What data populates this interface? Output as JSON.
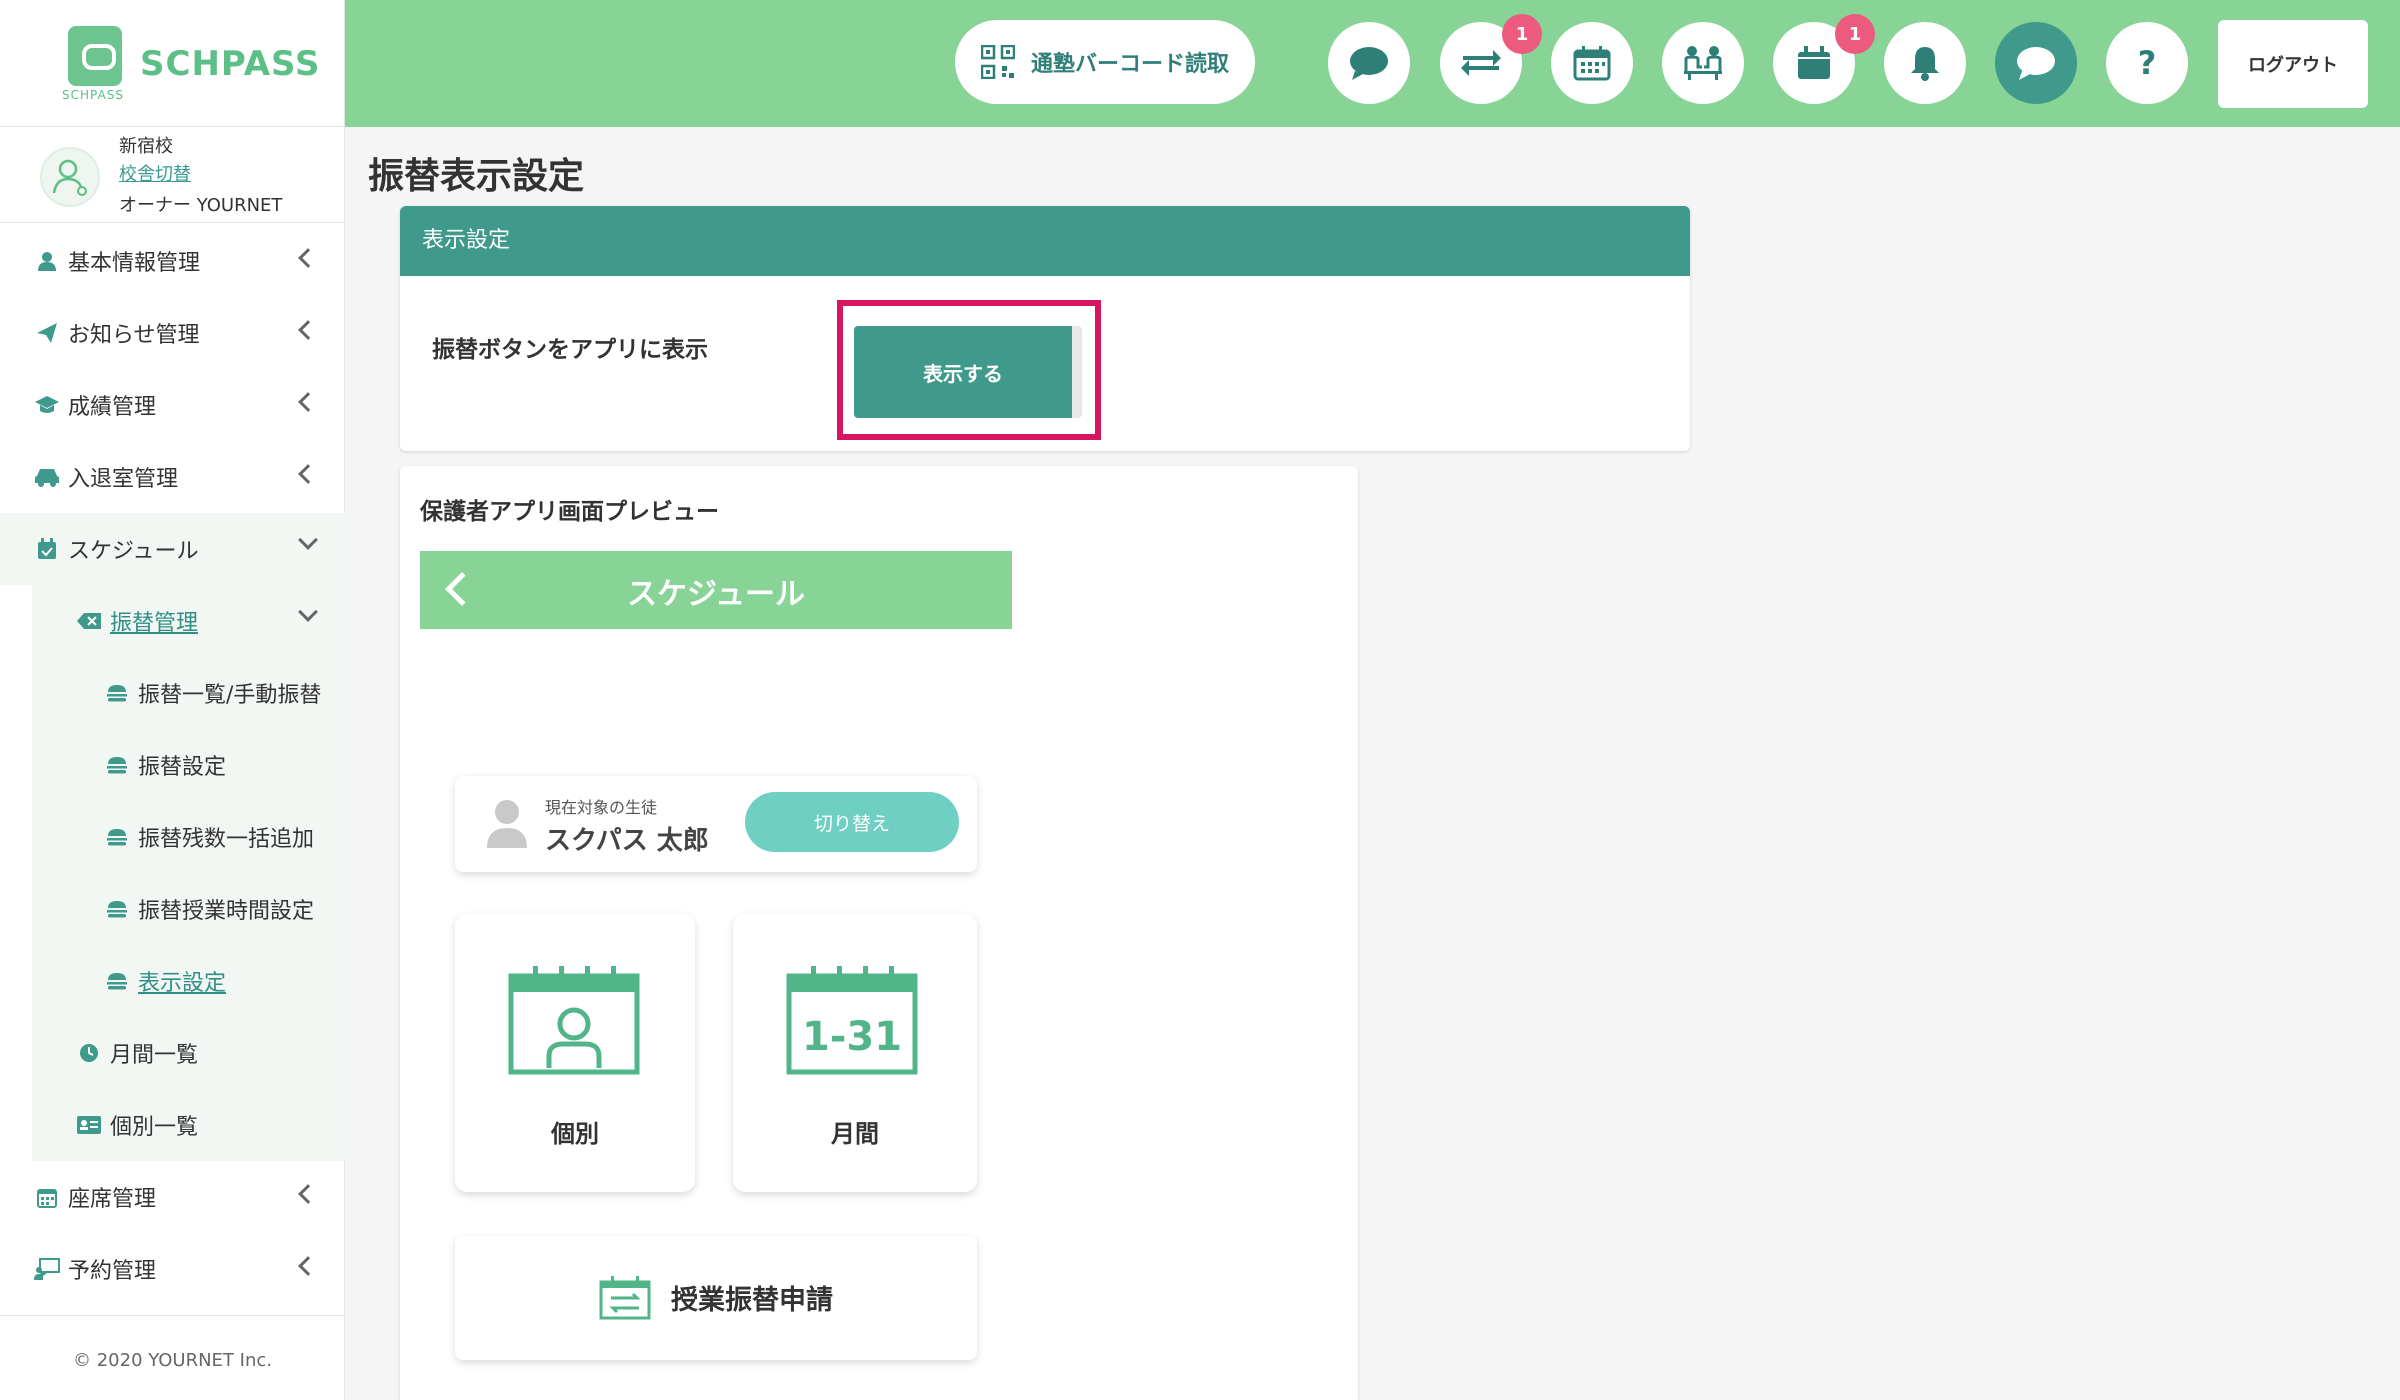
{
  "brand": {
    "name": "SCHPASS",
    "sub": "SCHPASS",
    "color": "#5bbf86"
  },
  "profile": {
    "school": "新宿校",
    "switch_label": "校舎切替",
    "owner": "オーナー YOURNET"
  },
  "sidebar": {
    "items": [
      {
        "label": "基本情報管理",
        "icon": "user-icon"
      },
      {
        "label": "お知らせ管理",
        "icon": "paper-plane-icon"
      },
      {
        "label": "成績管理",
        "icon": "graduation-cap-icon"
      },
      {
        "label": "入退室管理",
        "icon": "car-icon"
      },
      {
        "label": "スケジュール",
        "icon": "calendar-check-icon"
      },
      {
        "label": "振替管理",
        "icon": "backspace-icon"
      },
      {
        "label": "振替一覧/手動振替",
        "icon": "hamburger-icon"
      },
      {
        "label": "振替設定",
        "icon": "hamburger-icon"
      },
      {
        "label": "振替残数一括追加",
        "icon": "hamburger-icon"
      },
      {
        "label": "振替授業時間設定",
        "icon": "hamburger-icon"
      },
      {
        "label": "表示設定",
        "icon": "hamburger-icon"
      },
      {
        "label": "月間一覧",
        "icon": "clock-icon"
      },
      {
        "label": "個別一覧",
        "icon": "id-card-icon"
      },
      {
        "label": "座席管理",
        "icon": "grid-calendar-icon"
      },
      {
        "label": "予約管理",
        "icon": "teacher-board-icon"
      }
    ],
    "footer": "© 2020 YOURNET Inc."
  },
  "topbar": {
    "barcode_label": "通塾バーコード読取",
    "badges": {
      "transfer": "1",
      "gift": "1"
    },
    "help_label": "?",
    "logout_label": "ログアウト",
    "bg_color": "#88d396",
    "accent": "#3f9a8c"
  },
  "page": {
    "title": "振替表示設定"
  },
  "display_card": {
    "header": "表示設定",
    "row_label": "振替ボタンをアプリに表示",
    "button_label": "表示する"
  },
  "preview": {
    "title": "保護者アプリ画面プレビュー",
    "app_title": "スケジュール",
    "student_label": "現在対象の生徒",
    "student_name": "スクパス 太郎",
    "switch_label": "切り替え",
    "tile_individual": "個別",
    "tile_monthly": "月間",
    "calendar_range": "1-31",
    "request_label": "授業振替申請"
  }
}
